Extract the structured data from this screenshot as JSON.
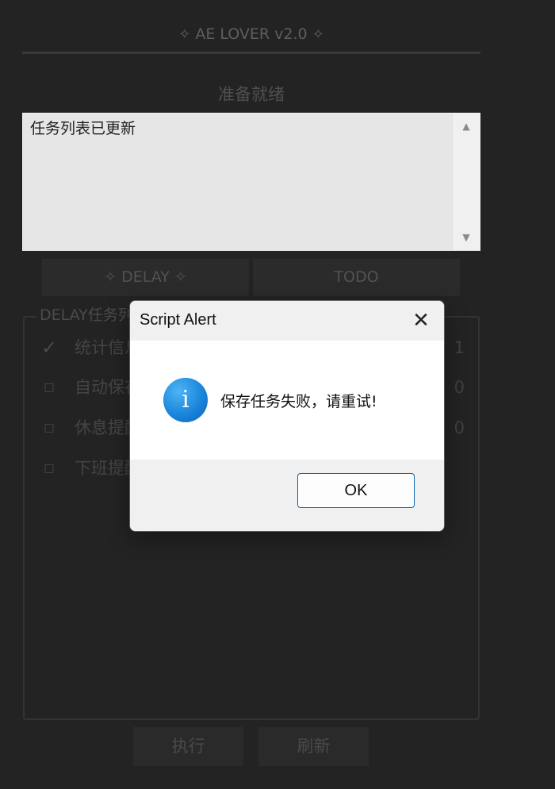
{
  "app": {
    "title": "AE LOVER v2.0",
    "title_spark": "✧",
    "status": "准备就绪"
  },
  "log": {
    "text": "任务列表已更新",
    "scroll_up_icon": "triangle-up-icon",
    "scroll_down_icon": "triangle-down-icon"
  },
  "tabs": {
    "delay_label": "DELAY",
    "todo_label": "TODO"
  },
  "group": {
    "legend": "DELAY任务列表",
    "tasks": [
      {
        "checked": true,
        "mark": "✓",
        "label": "统计信息",
        "time": "1"
      },
      {
        "checked": false,
        "mark": "□",
        "label": "自动保存",
        "time": "0"
      },
      {
        "checked": false,
        "mark": "□",
        "label": "休息提醒",
        "time": "0"
      },
      {
        "checked": false,
        "mark": "□",
        "label": "下班提醒",
        "time": ""
      }
    ]
  },
  "buttons": {
    "run_label": "执行",
    "refresh_label": "刷新"
  },
  "dialog": {
    "title": "Script Alert",
    "close_glyph": "✕",
    "info_glyph": "i",
    "message": "保存任务失败，请重试!",
    "ok_label": "OK"
  },
  "colors": {
    "background": "#232323",
    "dialog_accent": "#0a64ad",
    "info_blue": "#1a86dc"
  }
}
